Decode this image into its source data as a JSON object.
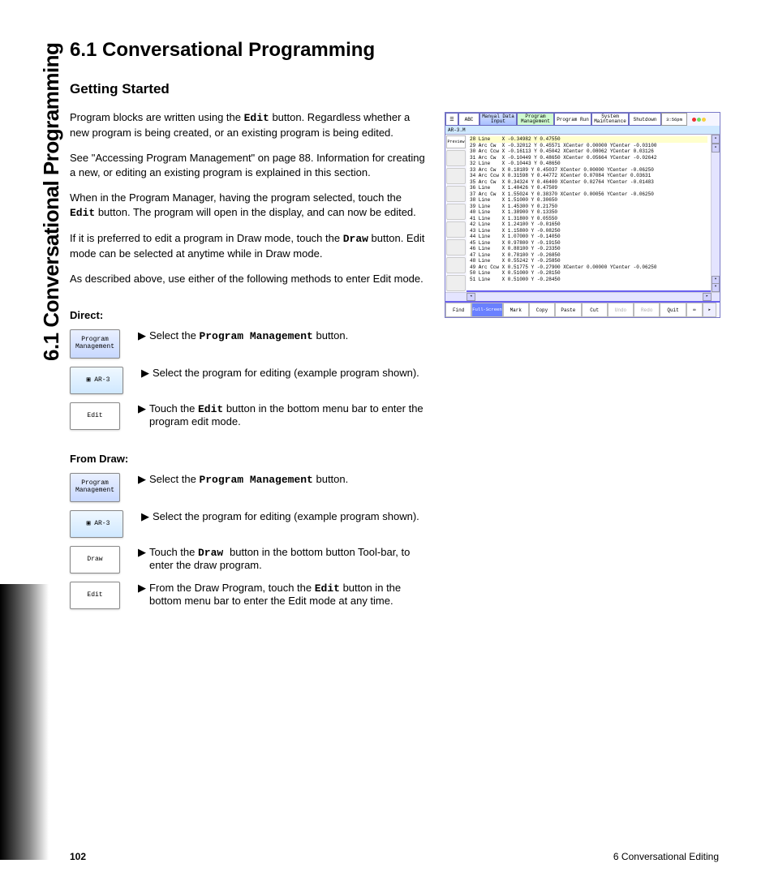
{
  "side_heading": "6.1 Conversational Programming",
  "title": "6.1  Conversational Programming",
  "subtitle": "Getting Started",
  "paras": {
    "p1a": "Program blocks are written using the ",
    "p1b": "Edit",
    "p1c": " button. Regardless whether a new program is being created, or an existing program is being edited.",
    "p2": "See \"Accessing Program Management\" on page 88.  Information for creating a new, or editing an existing program is explained in this section.",
    "p3a": "When in the Program Manager, having the program selected, touch the ",
    "p3b": "Edit",
    "p3c": " button. The program will open in the display, and can now be edited.",
    "p4a": "If it is preferred to edit a program in Draw mode, touch the ",
    "p4b": "Draw",
    "p4c": " button.  Edit mode can be selected at anytime while in Draw mode.",
    "p5": "As described above, use either of the following methods to enter Edit mode."
  },
  "direct_label": "Direct:",
  "from_draw_label": "From Draw:",
  "buttons": {
    "pm1": "Program",
    "pm2": "Management",
    "file": "AR-3",
    "edit": "Edit",
    "draw": "Draw"
  },
  "steps": {
    "d1a": "Select the ",
    "d1b": "Program Management",
    "d1c": " button.",
    "d2": "Select the program for editing (example program shown).",
    "d3a": "Touch the ",
    "d3b": "Edit",
    "d3c": " button in the bottom menu bar to enter the program edit mode.",
    "f1a": "Select the ",
    "f1b": "Program Management",
    "f1c": " button.",
    "f2": "Select the program for editing (example program shown).",
    "f3a": "Touch the ",
    "f3b": "Draw ",
    "f3c": "button in the bottom button Tool-bar, to enter the draw program.",
    "f4a": "From the Draw Program, touch the ",
    "f4b": "Edit",
    "f4c": " button in the bottom menu bar to enter the Edit mode at any time."
  },
  "footer": {
    "page": "102",
    "chapter": "6 Conversational Editing"
  },
  "shot": {
    "topbar": {
      "abc": "ABC",
      "mdi1": "Manual Data",
      "mdi2": "Input",
      "pm1": "Program",
      "pm2": "Management",
      "run": "Program Run",
      "sm1": "System",
      "sm2": "Maintenance",
      "shut": "Shutdown",
      "clock": "3:56pm"
    },
    "file": "AR-3.M",
    "preview": "Preview",
    "lines": [
      "28 Line    X -0.34982 Y 0.47550",
      "29 Arc Cw  X -0.32012 Y 0.45571 XCenter 0.00000 YCenter -0.03100",
      "30 Arc Ccw X -0.16113 Y 0.45042 XCenter 0.08062 YCenter 0.03126",
      "31 Arc Cw  X -0.10449 Y 0.48650 XCenter 0.05664 YCenter -0.02642",
      "32 Line    X -0.10443 Y 0.48650",
      "33 Arc Cw  X 0.18189 Y 0.45037 XCenter 0.00000 YCenter -0.06250",
      "34 Arc Ccw X 0.31598 Y 0.44772 XCenter 0.07084 YCenter 0.03631",
      "35 Arc Cw  X 0.34324 Y 0.46400 XCenter 0.02764 YCenter -0.01483",
      "36 Line    X 1.40426 Y 0.47509",
      "37 Arc Cw  X 1.55024 Y 0.38370 XCenter 0.00056 YCenter -0.06250",
      "38 Line    X 1.51000 Y 0.30650",
      "39 Line    X 1.45300 Y 0.21750",
      "40 Line    X 1.38900 Y 0.13350",
      "41 Line    X 1.31800 Y 0.05550",
      "42 Line    X 1.24100 Y -0.01650",
      "43 Line    X 1.15800 Y -0.08250",
      "44 Line    X 1.07000 Y -0.14050",
      "45 Line    X 0.97800 Y -0.19150",
      "46 Line    X 0.88100 Y -0.23350",
      "47 Line    X 0.78100 Y -0.26850",
      "48 Line    X 0.55242 Y -0.25850",
      "49 Arc Ccw X 0.51775 Y -0.27900 XCenter 0.00000 YCenter -0.06250",
      "50 Line    X 0.51000 Y -0.28150",
      "51 Line    X 0.51000 Y -0.28450"
    ],
    "bottom": {
      "find": "Find",
      "fs1": "Full-",
      "fs2": "Screen",
      "mark": "Mark",
      "copy": "Copy",
      "paste": "Paste",
      "cut": "Cut",
      "undo": "Undo",
      "redo": "Redo",
      "quit": "Quit"
    }
  }
}
